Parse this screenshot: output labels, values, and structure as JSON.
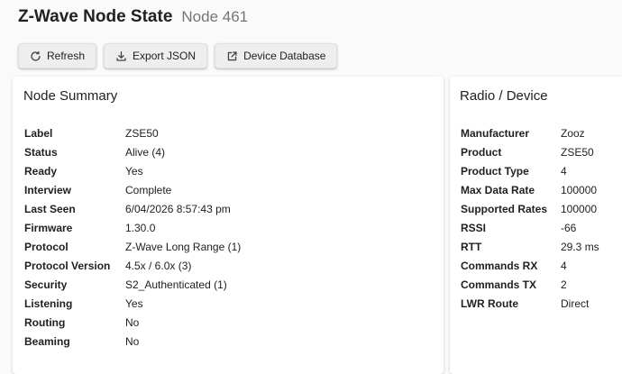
{
  "header": {
    "title": "Z-Wave Node State",
    "subtitle": "Node 461"
  },
  "toolbar": {
    "refresh_label": "Refresh",
    "export_label": "Export JSON",
    "device_db_label": "Device Database"
  },
  "summary": {
    "title": "Node Summary",
    "rows": [
      {
        "key": "Label",
        "value": "ZSE50"
      },
      {
        "key": "Status",
        "value": "Alive (4)"
      },
      {
        "key": "Ready",
        "value": "Yes"
      },
      {
        "key": "Interview",
        "value": "Complete"
      },
      {
        "key": "Last Seen",
        "value": "6/04/2026 8:57:43 pm"
      },
      {
        "key": "Firmware",
        "value": "1.30.0"
      },
      {
        "key": "Protocol",
        "value": "Z-Wave Long Range (1)"
      },
      {
        "key": "Protocol Version",
        "value": "4.5x / 6.0x (3)"
      },
      {
        "key": "Security",
        "value": "S2_Authenticated (1)"
      },
      {
        "key": "Listening",
        "value": "Yes"
      },
      {
        "key": "Routing",
        "value": "No"
      },
      {
        "key": "Beaming",
        "value": "No"
      }
    ]
  },
  "radio": {
    "title": "Radio / Device",
    "rows": [
      {
        "key": "Manufacturer",
        "value": "Zooz"
      },
      {
        "key": "Product",
        "value": "ZSE50"
      },
      {
        "key": "Product Type",
        "value": "4"
      },
      {
        "key": "Max Data Rate",
        "value": "100000"
      },
      {
        "key": "Supported Rates",
        "value": "100000"
      },
      {
        "key": "RSSI",
        "value": "-66"
      },
      {
        "key": "RTT",
        "value": "29.3 ms"
      },
      {
        "key": "Commands RX",
        "value": "4"
      },
      {
        "key": "Commands TX",
        "value": "2"
      },
      {
        "key": "LWR Route",
        "value": "Direct"
      }
    ]
  }
}
